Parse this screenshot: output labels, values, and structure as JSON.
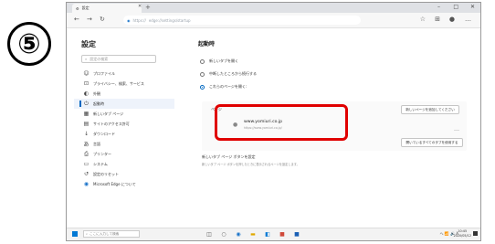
{
  "step_number": "⑤",
  "browser": {
    "tab_title": "設定",
    "address_prefix": "https://",
    "address_path": "edge://settings/startup"
  },
  "sidebar": {
    "title": "設定",
    "search_placeholder": "設定の検索",
    "items": [
      {
        "label": "プロファイル",
        "icon": "person-icon"
      },
      {
        "label": "プライバシー、検索、サービス",
        "icon": "lock-icon"
      },
      {
        "label": "外観",
        "icon": "palette-icon"
      },
      {
        "label": "起動時",
        "icon": "power-icon",
        "active": true
      },
      {
        "label": "新しいタブ ページ",
        "icon": "newtab-icon"
      },
      {
        "label": "サイトのアクセス許可",
        "icon": "permissions-icon"
      },
      {
        "label": "ダウンロード",
        "icon": "download-icon"
      },
      {
        "label": "言語",
        "icon": "language-icon"
      },
      {
        "label": "プリンター",
        "icon": "printer-icon"
      },
      {
        "label": "システム",
        "icon": "system-icon"
      },
      {
        "label": "設定のリセット",
        "icon": "reset-icon"
      },
      {
        "label": "Microsoft Edge について",
        "icon": "edge-icon"
      }
    ]
  },
  "main": {
    "section_title": "起動時",
    "options": [
      {
        "label": "新しいタブを開く",
        "selected": false
      },
      {
        "label": "中断したところから続行する",
        "selected": false
      },
      {
        "label": "これらのページを開く:",
        "selected": true
      }
    ],
    "pages_label": "ページ",
    "add_page_button": "新しいページを追加してください",
    "use_open_tabs_button": "開いているすべてのタブを使用する",
    "startup_page": {
      "url": "www.yomiuri.co.jp",
      "subtitle": "https://www.yomiuri.co.jp/"
    },
    "note_title": "新しいタブ ページ ボタンを設定",
    "note_body": "新しいタブ ページ ボタンを押したときに表示されるページを設定します。"
  },
  "taskbar": {
    "search_placeholder": "ここに入力して検索",
    "time": "10:45",
    "date": "2020/05/12",
    "tray": "へ 📶 🔊 A"
  },
  "colors": {
    "accent": "#0067c0",
    "highlight": "#e00000"
  }
}
